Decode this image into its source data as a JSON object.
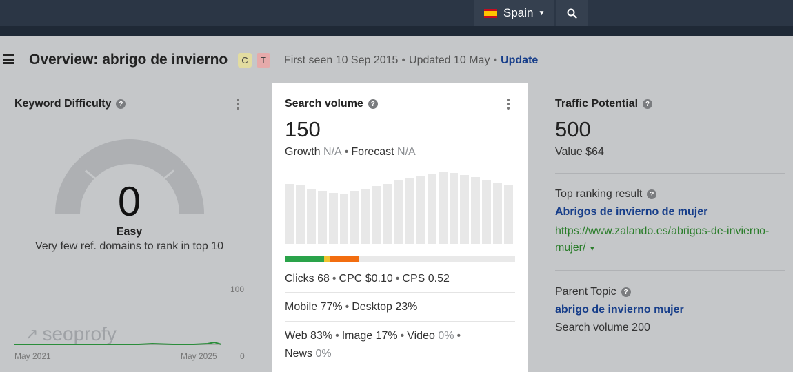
{
  "topbar": {
    "country": "Spain"
  },
  "header": {
    "title": "Overview: abrigo de invierno",
    "badge_c": "C",
    "badge_t": "T",
    "first_seen": "First seen 10 Sep 2015",
    "updated": "Updated 10 May",
    "update_link": "Update"
  },
  "keyword_difficulty": {
    "title": "Keyword Difficulty",
    "value": "0",
    "label": "Easy",
    "description": "Very few ref. domains to rank in top 10",
    "chart_max": "100",
    "chart_min": "0",
    "x_start": "May 2021",
    "x_end": "May 2025",
    "watermark": "seoprofy"
  },
  "search_volume": {
    "title": "Search volume",
    "value": "150",
    "growth_label": "Growth",
    "growth_value": "N/A",
    "forecast_label": "Forecast",
    "forecast_value": "N/A",
    "bar_heights": [
      84,
      82,
      77,
      74,
      71,
      70,
      74,
      77,
      81,
      84,
      88,
      91,
      95,
      98,
      100,
      99,
      96,
      93,
      89,
      86,
      83
    ],
    "clicks": "Clicks 68",
    "cpc": "CPC $0.10",
    "cps": "CPS 0.52",
    "mobile": "Mobile 77%",
    "desktop": "Desktop 23%",
    "web": "Web 83%",
    "image": "Image 17%",
    "video_label": "Video",
    "video_value": "0%",
    "news_label": "News",
    "news_value": "0%"
  },
  "traffic_potential": {
    "title": "Traffic Potential",
    "value": "500",
    "value_text": "Value $64",
    "top_result_label": "Top ranking result",
    "top_result_title": "Abrigos de invierno de mujer",
    "top_result_url_line1": "https://www.zalando.es/abrigos-de-invierno-",
    "top_result_url_line2": "mujer/",
    "parent_topic_label": "Parent Topic",
    "parent_topic_link": "abrigo de invierno mujer",
    "parent_topic_volume": "Search volume 200"
  },
  "colors": {
    "topbar": "#2b3645",
    "link_blue": "#173e8a",
    "link_green": "#2a7d2a",
    "clicks_green": "#2aa34a",
    "clicks_yellow": "#f2c230",
    "clicks_orange": "#f26d10"
  }
}
